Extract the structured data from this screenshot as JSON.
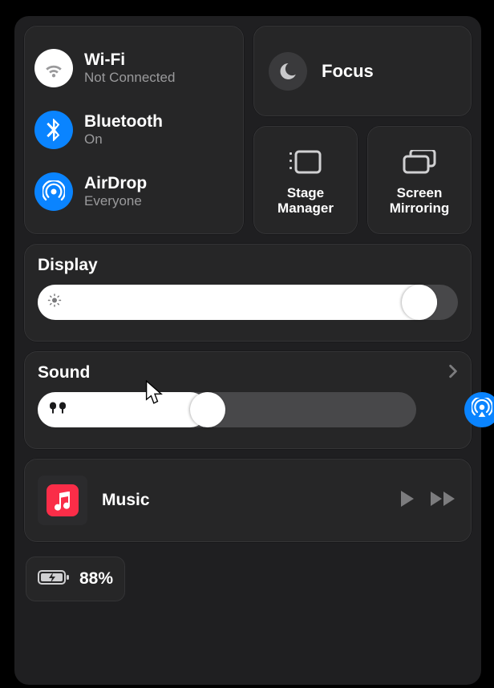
{
  "connectivity": {
    "wifi": {
      "title": "Wi-Fi",
      "sub": "Not Connected",
      "state": "off"
    },
    "bluetooth": {
      "title": "Bluetooth",
      "sub": "On",
      "state": "on"
    },
    "airdrop": {
      "title": "AirDrop",
      "sub": "Everyone",
      "state": "on"
    }
  },
  "focus": {
    "label": "Focus",
    "state": "off"
  },
  "tiles": {
    "stage": {
      "label": "Stage\nManager"
    },
    "mirror": {
      "label": "Screen\nMirroring"
    }
  },
  "display": {
    "title": "Display",
    "value_pct": 95
  },
  "sound": {
    "title": "Sound",
    "value_pct": 45
  },
  "media": {
    "app": "Music"
  },
  "battery": {
    "level_pct": "88%",
    "charging": true
  }
}
